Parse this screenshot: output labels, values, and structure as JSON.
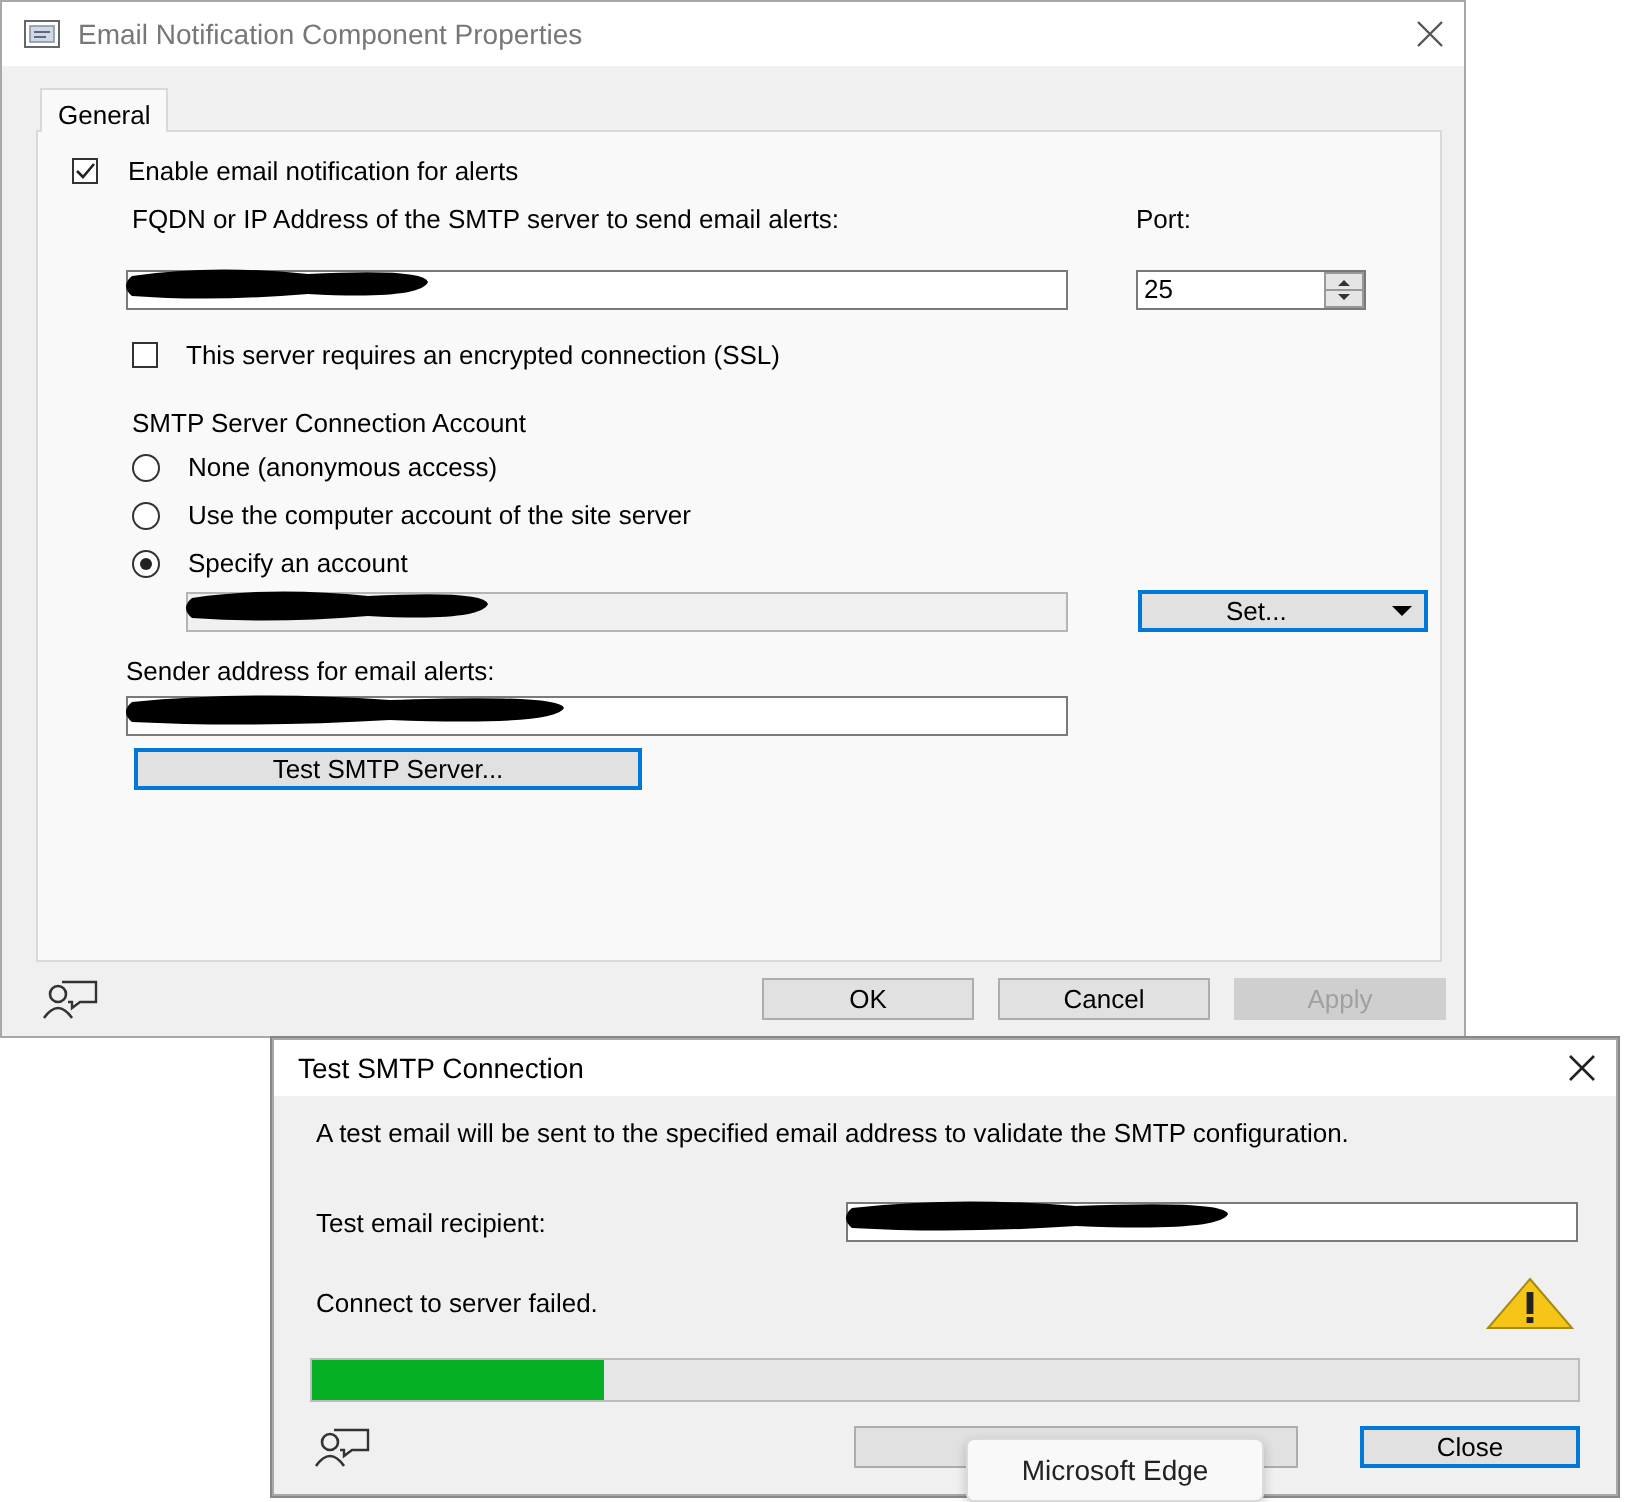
{
  "properties_dialog": {
    "title": "Email Notification Component Properties",
    "tabs": [
      {
        "label": "General",
        "selected": true
      }
    ],
    "enable_notifications": {
      "label": "Enable email notification for alerts",
      "checked": true
    },
    "server_label": "FQDN or IP Address of the SMTP server to send email alerts:",
    "server_field": {
      "redacted": true
    },
    "port_label": "Port:",
    "port_value": "25",
    "ssl": {
      "label": "This server requires an encrypted connection (SSL)",
      "checked": false
    },
    "account_heading": "SMTP Server Connection Account",
    "account_options": [
      {
        "label": "None (anonymous access)",
        "selected": false
      },
      {
        "label": "Use the computer account of the site server",
        "selected": false
      },
      {
        "label": "Specify an account",
        "selected": true
      }
    ],
    "account_field": {
      "redacted": true,
      "disabled": true
    },
    "set_button": "Set...",
    "sender_label": "Sender address for email alerts:",
    "sender_field": {
      "redacted": true
    },
    "test_button": "Test SMTP Server...",
    "buttons": [
      {
        "label": "OK",
        "disabled": false
      },
      {
        "label": "Cancel",
        "disabled": false
      },
      {
        "label": "Apply",
        "disabled": true
      }
    ]
  },
  "test_dialog": {
    "title": "Test SMTP Connection",
    "description": "A test email will be sent to the specified email address to validate the SMTP configuration.",
    "recipient_label": "Test email recipient:",
    "recipient_field": {
      "redacted": true
    },
    "status": "Connect to server failed.",
    "progress": {
      "level": 0.23
    },
    "buttons": [
      {
        "kind": "covered"
      },
      {
        "kind": "labeled",
        "label": "Close",
        "focused": true
      }
    ]
  },
  "tooltip": "Microsoft Edge"
}
